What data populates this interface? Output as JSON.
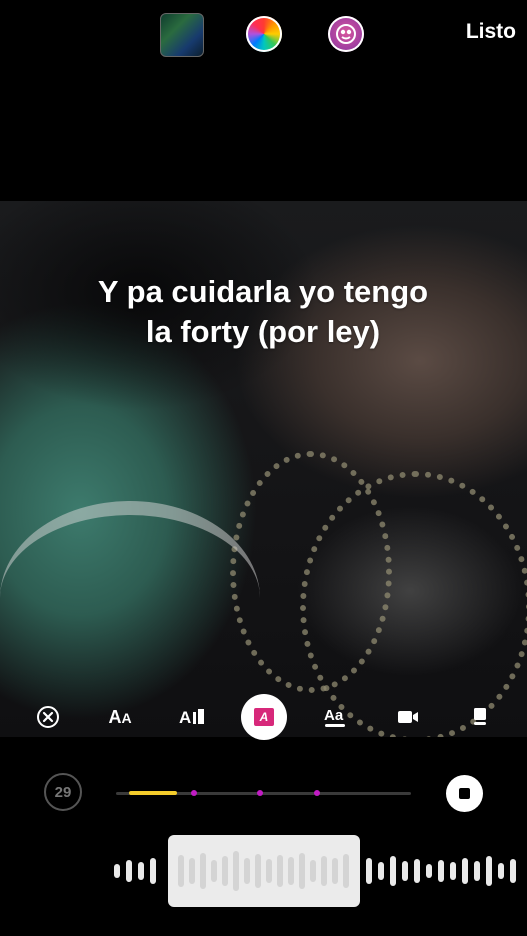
{
  "header": {
    "album_cover_text_top": "",
    "album_cover_text_bottom": "",
    "done_label": "Listo"
  },
  "caption": {
    "text": "Y pa cuidarla yo tengo la forty (por ley)"
  },
  "tools": [
    {
      "name": "close",
      "label": "⊗"
    },
    {
      "name": "font-size",
      "label": "AA"
    },
    {
      "name": "text-style",
      "label": "A"
    },
    {
      "name": "lyrics-style",
      "label": "A"
    },
    {
      "name": "font",
      "label": "Aa"
    },
    {
      "name": "video",
      "label": ""
    },
    {
      "name": "placement",
      "label": ""
    }
  ],
  "timeline": {
    "duration_seconds": "29",
    "selection_fraction": 0.16
  },
  "colors": {
    "accent_yellow": "#f4cc2b",
    "marker_magenta": "#c21cc4",
    "active_tool": "#d7287a"
  }
}
